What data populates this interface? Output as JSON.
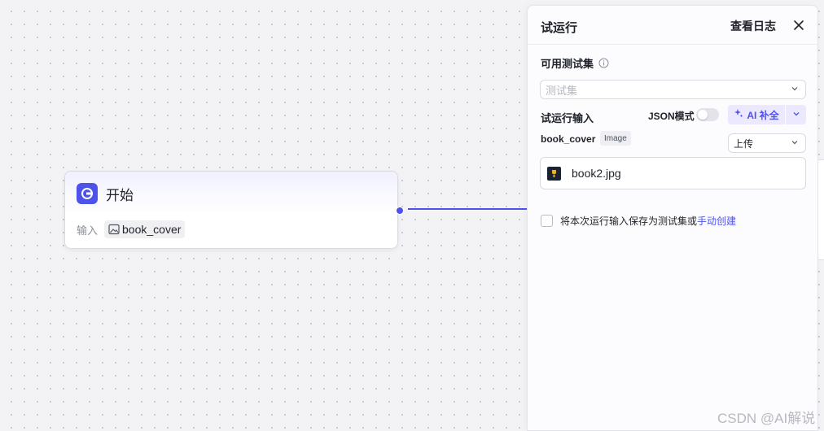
{
  "canvas": {
    "start_node": {
      "title": "开始",
      "input_label": "输入",
      "input_field": "book_cover"
    }
  },
  "panel": {
    "title": "试运行",
    "view_log": "查看日志",
    "testset_label": "可用测试集",
    "testset_placeholder": "测试集",
    "run_input_label": "试运行输入",
    "json_mode_label": "JSON模式",
    "json_mode_on": false,
    "ai_fill_label": "AI 补全",
    "field": {
      "name": "book_cover",
      "type": "Image",
      "source": "上传",
      "file_name": "book2.jpg"
    },
    "save_text": "将本次运行输入保存为测试集或",
    "manual_create": "手动创建"
  },
  "watermark": "CSDN @AI解说",
  "colors": {
    "accent": "#4d53e8",
    "ai_button_bg": "#ece8ff"
  }
}
